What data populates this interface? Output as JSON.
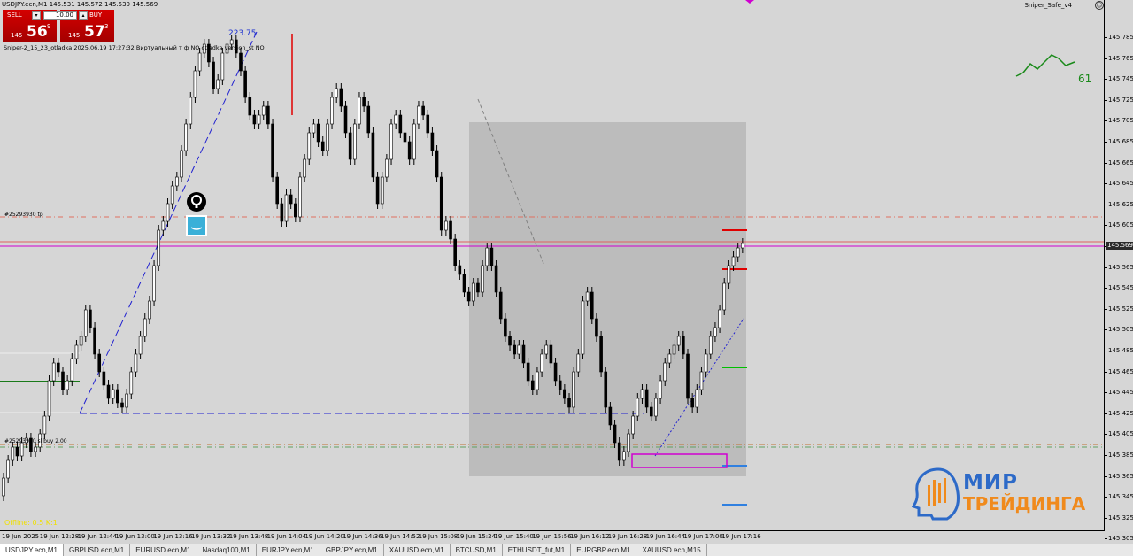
{
  "window": {
    "symbol_title": "USDJPY.ecn,M1  145.531 145.572 145.530 145.569",
    "ea_name": "Sniper_Safe_v4",
    "smile": "☺"
  },
  "oneclick": {
    "sell_label": "SELL",
    "buy_label": "BUY",
    "lot_value": "10.00",
    "lot_down": "▾",
    "lot_up": "▴",
    "sell_prefix": "145",
    "sell_big": "56",
    "sell_sup": "9",
    "buy_prefix": "145",
    "buy_big": "57",
    "buy_sup": "3"
  },
  "info_line": "Sniper-2_15_23_otladka   2025.06.19 17:27:32   Виртуальный т ф NO   otladka   version_st NO",
  "labels": {
    "level": "223.75",
    "ob_top": "#25293930 tp",
    "ob_bottom": "#25293930 sl buy 2.00",
    "status": "Offline: 0.5 K:1",
    "mini_number": "61"
  },
  "watermark": {
    "line1": "МИР",
    "line2": "ТРЕЙДИНГА"
  },
  "colors": {
    "chart_bg": "#d6d6d6",
    "candle": "#000000",
    "box": "#b0b0b0",
    "accent_red": "#e00000",
    "accent_green": "#00c000",
    "magenta": "#d000d0",
    "blue_dash": "#2020d0"
  },
  "price_axis": {
    "ticks": [
      "145.785",
      "145.765",
      "145.745",
      "145.725",
      "145.705",
      "145.685",
      "145.665",
      "145.645",
      "145.625",
      "145.605",
      "145.585",
      "145.565",
      "145.545",
      "145.525",
      "145.505",
      "145.485",
      "145.465",
      "145.445",
      "145.425",
      "145.405",
      "145.385",
      "145.365",
      "145.345",
      "145.325",
      "145.305"
    ],
    "current_price": "145.569"
  },
  "time_axis": {
    "ticks": [
      "19 Jun 2025",
      "19 Jun 12:28",
      "19 Jun 12:44",
      "19 Jun 13:00",
      "19 Jun 13:16",
      "19 Jun 13:32",
      "19 Jun 13:48",
      "19 Jun 14:04",
      "19 Jun 14:20",
      "19 Jun 14:36",
      "19 Jun 14:52",
      "19 Jun 15:08",
      "19 Jun 15:24",
      "19 Jun 15:40",
      "19 Jun 15:56",
      "19 Jun 16:12",
      "19 Jun 16:28",
      "19 Jun 16:44",
      "19 Jun 17:00",
      "19 Jun 17:16"
    ]
  },
  "tabs": [
    "USDJPY.ecn,M1",
    "GBPUSD.ecn,M1",
    "EURUSD.ecn,M1",
    "Nasdaq100,M1",
    "EURJPY.ecn,M1",
    "GBPJPY.ecn,M1",
    "XAUUSD.ecn,M1",
    "BTCUSD,M1",
    "ETHUSDT_fut,M1",
    "EURGBP.ecn,M1",
    "XAUUSD.ecn,M15"
  ]
}
